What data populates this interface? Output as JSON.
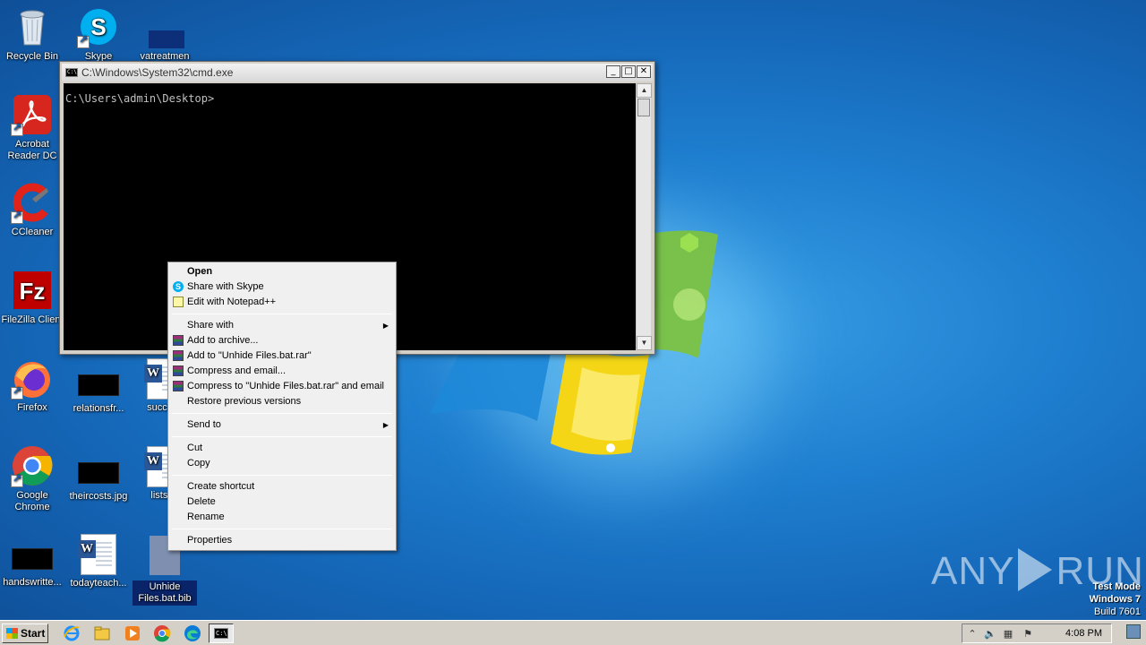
{
  "desktop": {
    "icons": [
      {
        "label": "Recycle Bin"
      },
      {
        "label": "Skype"
      },
      {
        "label": "vatreatmen"
      },
      {
        "label": "Acrobat Reader DC"
      },
      {
        "label": "CCleaner"
      },
      {
        "label": "FileZilla Client"
      },
      {
        "label": "Firefox"
      },
      {
        "label": "relationsfr..."
      },
      {
        "label": "success"
      },
      {
        "label": "Google Chrome"
      },
      {
        "label": "theircosts.jpg"
      },
      {
        "label": "listsbe"
      },
      {
        "label": "handswritte..."
      },
      {
        "label": "todayteach..."
      },
      {
        "label": "Unhide Files.bat.bib"
      }
    ]
  },
  "cmd_window": {
    "title": "C:\\Windows\\System32\\cmd.exe",
    "prompt": "C:\\Users\\admin\\Desktop>",
    "minimize": "_",
    "maximize": "□",
    "close": "✕"
  },
  "context_menu": {
    "items": [
      {
        "label": "Open"
      },
      {
        "label": "Share with Skype"
      },
      {
        "label": "Edit with Notepad++"
      },
      {
        "label": "Share with"
      },
      {
        "label": "Add to archive..."
      },
      {
        "label": "Add to \"Unhide Files.bat.rar\""
      },
      {
        "label": "Compress and email..."
      },
      {
        "label": "Compress to \"Unhide Files.bat.rar\" and email"
      },
      {
        "label": "Restore previous versions"
      },
      {
        "label": "Send to"
      },
      {
        "label": "Cut"
      },
      {
        "label": "Copy"
      },
      {
        "label": "Create shortcut"
      },
      {
        "label": "Delete"
      },
      {
        "label": "Rename"
      },
      {
        "label": "Properties"
      }
    ]
  },
  "taskbar": {
    "start_label": "Start",
    "clock": "4:08 PM"
  },
  "watermark": {
    "brand_left": "ANY",
    "brand_right": "RUN",
    "mode": "Test Mode",
    "os": "Windows 7",
    "build": "Build 7601"
  }
}
